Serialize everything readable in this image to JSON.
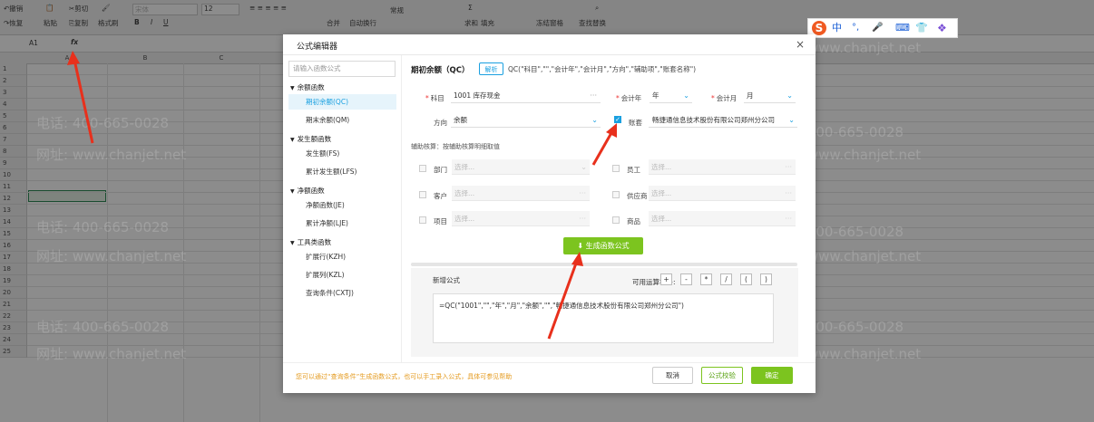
{
  "ribbon": {
    "undo": "撤销",
    "redo": "恢复",
    "paste_icon_label": "粘贴",
    "cut": "剪切",
    "copy": "复制",
    "format_painter": "格式刷",
    "font_name": "宋体",
    "font_size": "12",
    "bold": "B",
    "italic": "I",
    "underline": "U",
    "merge": "合并",
    "wrap": "自动换行",
    "number_format": "常规",
    "sum": "求和",
    "fill": "填充",
    "freeze": "冻结窗格",
    "find_replace": "查找替换"
  },
  "formula_bar": {
    "cell_ref": "A1",
    "fx": "fx"
  },
  "grid": {
    "columns": [
      "A",
      "B",
      "C"
    ],
    "rows": [
      "1",
      "2",
      "3",
      "4",
      "5",
      "6",
      "7",
      "8",
      "9",
      "10",
      "11",
      "12",
      "13",
      "14",
      "15",
      "16",
      "17",
      "18",
      "19",
      "20",
      "21",
      "22",
      "23",
      "24",
      "25"
    ]
  },
  "watermarks": [
    "电话: 400-665-0028",
    "网址: www.chanjet.net"
  ],
  "ime": {
    "logo": "S",
    "lang": "中",
    "punct": "°,",
    "mic": "🎤",
    "keyboard": "⌨",
    "skin": "👕",
    "apps": "❖"
  },
  "dialog": {
    "title": "公式编辑器",
    "close": "×",
    "search_placeholder": "请输入函数公式",
    "tree": [
      {
        "group": "余额函数",
        "items": [
          "期初余额(QC)",
          "期末余额(QM)"
        ]
      },
      {
        "group": "发生额函数",
        "items": [
          "发生额(FS)",
          "累计发生额(LFS)"
        ]
      },
      {
        "group": "净额函数",
        "items": [
          "净额函数(JE)",
          "累计净额(LJE)"
        ]
      },
      {
        "group": "工具类函数",
        "items": [
          "扩展行(KZH)",
          "扩展列(KZL)",
          "查询条件(CXTJ)"
        ]
      }
    ],
    "function_title": "期初余额（QC）",
    "parse_label": "解析",
    "syntax": "QC(\"科目\",\"\",\"会计年\",\"会计月\",\"方向\",\"辅助项\",\"账套名称\")",
    "fields": {
      "subject_label": "科目",
      "subject_value": "1001 库存现金",
      "year_label": "会计年",
      "year_value": "年",
      "month_label": "会计月",
      "month_value": "月",
      "direction_label": "方向",
      "direction_value": "余额",
      "ledger_label": "账套",
      "ledger_value": "畅捷通信息技术股份有限公司郑州分公司"
    },
    "aux_hint": "辅助核算：按辅助核算明细取值",
    "aux": [
      {
        "label": "部门",
        "placeholder": "选择..."
      },
      {
        "label": "员工",
        "placeholder": "选择..."
      },
      {
        "label": "客户",
        "placeholder": "选择..."
      },
      {
        "label": "供应商",
        "placeholder": "选择..."
      },
      {
        "label": "项目",
        "placeholder": "选择..."
      },
      {
        "label": "商品",
        "placeholder": "选择..."
      }
    ],
    "generate_button": "生成函数公式",
    "new_formula_label": "新增公式",
    "ops_label": "可用运算符号:",
    "ops": [
      "+",
      "-",
      "*",
      "/",
      "(",
      ")"
    ],
    "formula_text": "=QC(\"1001\",\"\",\"年\",\"月\",\"余额\",\"\",\"畅捷通信息技术股份有限公司郑州分公司\")",
    "footer_hint": "您可以通过“查询条件”生成函数公式，也可以手工录入公式，具体可参见帮助",
    "cancel": "取消",
    "check": "公式校验",
    "ok": "确定"
  },
  "colors": {
    "accent_blue": "#1aa0e0",
    "green": "#7cc41f",
    "arrow_red": "#e8301c",
    "hint_orange": "#e49a1e"
  }
}
